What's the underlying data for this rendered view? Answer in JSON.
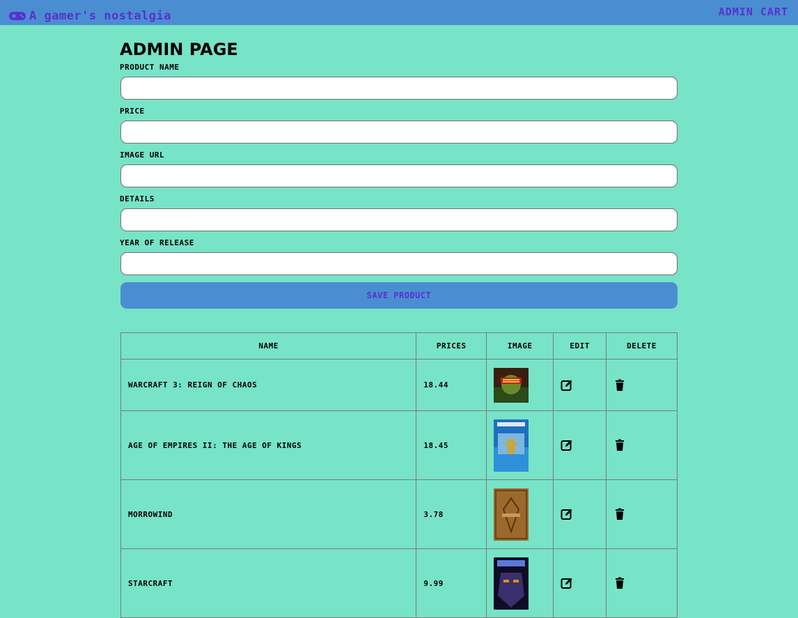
{
  "navbar": {
    "brand": "A gamer's nostalgia",
    "brand_icon": "gamepad-icon",
    "links": [
      "ADMIN",
      "CART"
    ]
  },
  "page": {
    "title": "ADMIN PAGE"
  },
  "form": {
    "product_name_label": "PRODUCT NAME",
    "price_label": "PRICE",
    "image_url_label": "IMAGE URL",
    "details_label": "DETAILS",
    "year_label": "YEAR OF RELEASE",
    "product_name_value": "",
    "price_value": "",
    "image_url_value": "",
    "details_value": "",
    "year_value": "",
    "save_label": "SAVE PRODUCT"
  },
  "table": {
    "headers": [
      "NAME",
      "PRICES",
      "IMAGE",
      "EDIT",
      "DELETE"
    ],
    "rows": [
      {
        "name": "WARCRAFT 3: REIGN OF CHAOS",
        "price": "18.44",
        "image": "warcraft-3-cover",
        "edit_icon": "edit-icon",
        "delete_icon": "trash-icon"
      },
      {
        "name": "AGE OF EMPIRES II: THE AGE OF KINGS",
        "price": "18.45",
        "image": "age-of-empires-2-cover",
        "edit_icon": "edit-icon",
        "delete_icon": "trash-icon"
      },
      {
        "name": "MORROWIND",
        "price": "3.78",
        "image": "morrowind-cover",
        "edit_icon": "edit-icon",
        "delete_icon": "trash-icon"
      },
      {
        "name": "STARCRAFT",
        "price": "9.99",
        "image": "starcraft-cover",
        "edit_icon": "edit-icon",
        "delete_icon": "trash-icon"
      }
    ]
  },
  "colors": {
    "background": "#77e3c7",
    "navbar": "#4a8ed1",
    "accent_text": "#5a2fd0",
    "border": "#7a7a7a"
  }
}
